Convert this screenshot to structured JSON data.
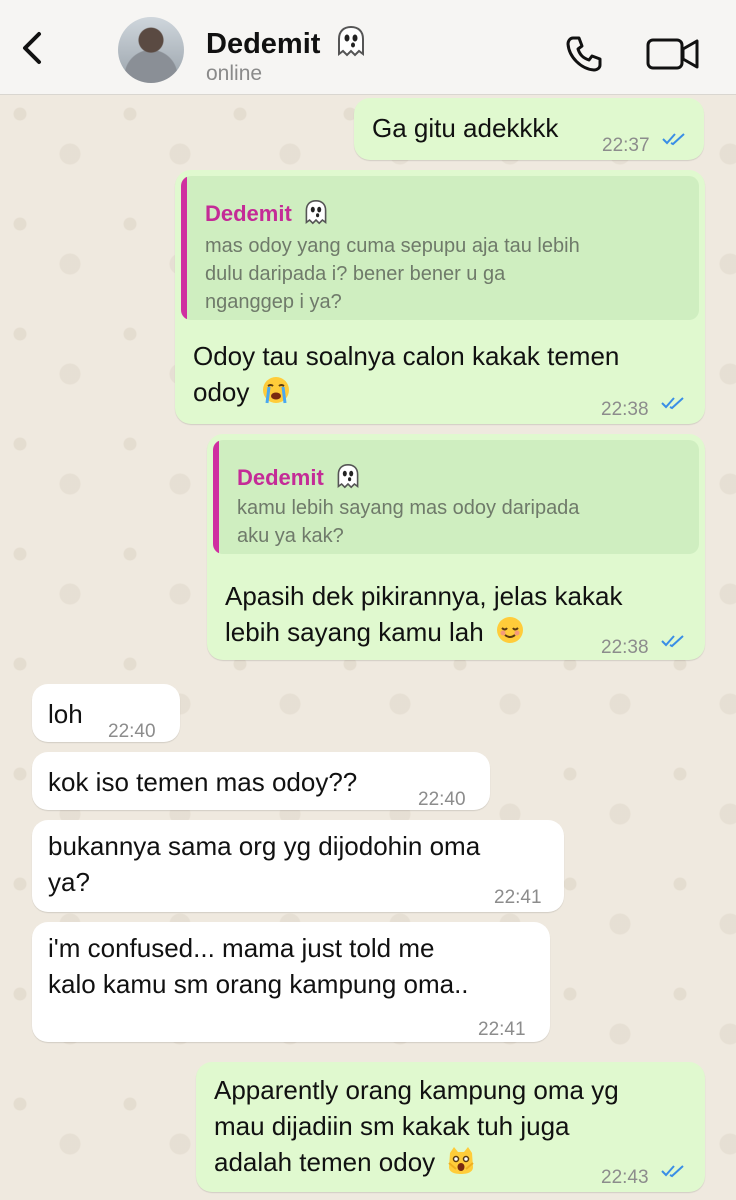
{
  "header": {
    "contact_name": "Dedemit",
    "status": "online"
  },
  "colors": {
    "outgoing_bubble": "#e0f9cf",
    "incoming_bubble": "#ffffff",
    "quote_accent": "#cf2fa0",
    "read_ticks": "#3a8ee6"
  },
  "messages": [
    {
      "direction": "out",
      "text": "Ga gitu adekkkk",
      "time": "22:37",
      "read": true
    },
    {
      "direction": "out",
      "reply_to": {
        "name": "Dedemit",
        "text_lines": [
          "mas odoy yang cuma sepupu aja tau lebih",
          "dulu daripada i? bener bener u ga",
          "nganggep i ya?"
        ]
      },
      "text_lines": [
        "Odoy tau soalnya calon kakak temen",
        "odoy"
      ],
      "emoji": "loudly-crying-face",
      "time": "22:38",
      "read": true
    },
    {
      "direction": "out",
      "reply_to": {
        "name": "Dedemit",
        "text_lines": [
          "kamu lebih sayang mas odoy daripada",
          "aku ya kak?"
        ]
      },
      "text_lines": [
        "Apasih dek pikirannya, jelas kakak",
        "lebih sayang kamu lah"
      ],
      "emoji": "relieved-face",
      "time": "22:38",
      "read": true
    },
    {
      "direction": "in",
      "text": "loh",
      "time": "22:40"
    },
    {
      "direction": "in",
      "text": "kok iso temen mas odoy??",
      "time": "22:40"
    },
    {
      "direction": "in",
      "text_lines": [
        "bukannya sama org yg dijodohin oma",
        "ya?"
      ],
      "time": "22:41"
    },
    {
      "direction": "in",
      "text_lines": [
        "i'm confused... mama just told me",
        "kalo kamu sm orang kampung oma.."
      ],
      "time": "22:41"
    },
    {
      "direction": "out",
      "text_lines": [
        "Apparently orang kampung oma yg",
        "mau dijadiin sm kakak tuh juga",
        "adalah temen odoy"
      ],
      "emoji": "weary-cat-face",
      "time": "22:43",
      "read": true
    }
  ]
}
